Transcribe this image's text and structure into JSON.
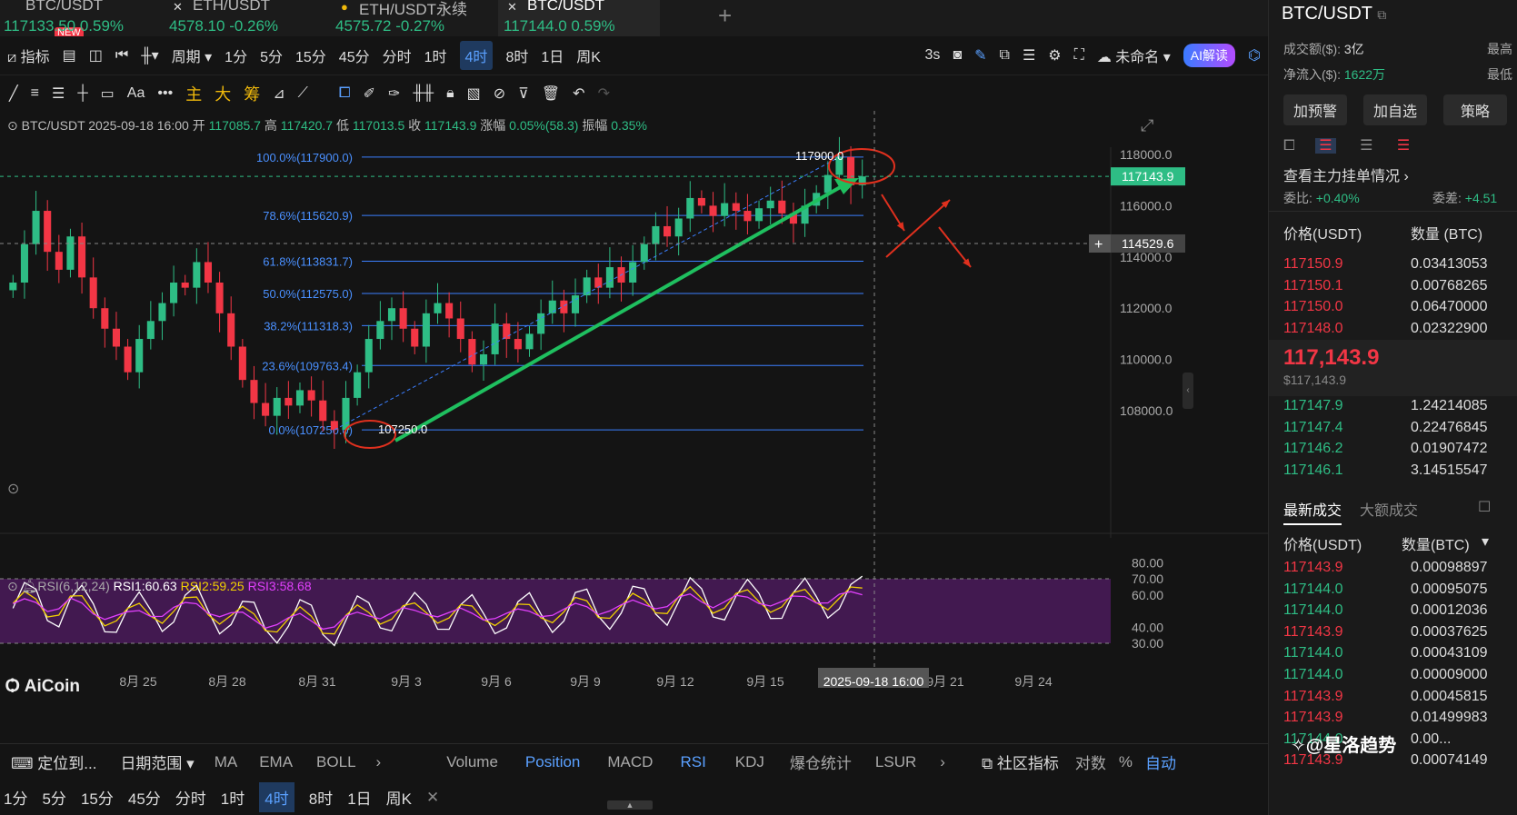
{
  "tabs": [
    {
      "name": "BTC/USDT",
      "price": "117133.50",
      "pct": "0.59%",
      "active": false,
      "icon": "",
      "badge": "NEW",
      "pcolor": "#2ebd85"
    },
    {
      "name": "ETH/USDT",
      "price": "4578.10",
      "pct": "-0.26%",
      "active": false,
      "icon": "✕",
      "pcolor": "#2ebd85"
    },
    {
      "name": "ETH/USDT永续",
      "price": "4575.72",
      "pct": "-0.27%",
      "active": false,
      "icon": "●",
      "pcolor": "#2ebd85"
    },
    {
      "name": "BTC/USDT",
      "price": "117144.0",
      "pct": "0.59%",
      "active": true,
      "icon": "✕",
      "pcolor": "#2ebd85"
    }
  ],
  "toolbar1": {
    "indicator": "指标",
    "period": "周期",
    "intervals": [
      "1分",
      "5分",
      "15分",
      "45分",
      "分时",
      "1时",
      "4时",
      "8时",
      "1日",
      "周K"
    ],
    "active_interval": "4时",
    "refresh": "3s",
    "layout_name": "未命名",
    "ai": "AI解读"
  },
  "toolbar2": {
    "main": "主",
    "big": "大",
    "chip": "筹"
  },
  "chart": {
    "info": {
      "symbol": "BTC/USDT",
      "datetime": "2025-09-18 16:00",
      "open_label": "开",
      "open": "117085.7",
      "high_label": "高",
      "high": "117420.7",
      "low_label": "低",
      "low": "117013.5",
      "close_label": "收",
      "close": "117143.9",
      "chg_label": "涨幅",
      "chg": "0.05%(58.3)",
      "amp_label": "振幅",
      "amp": "0.35%"
    },
    "y_ticks": [
      "118000.0",
      "116000.0",
      "114000.0",
      "112000.0",
      "110000.0",
      "108000.0"
    ],
    "price_tag": "117143.9",
    "cross_tag": "114529.6",
    "fib": [
      {
        "label": "100.0%(117900.0)",
        "value": 117900
      },
      {
        "label": "78.6%(115620.9)",
        "value": 115620.9
      },
      {
        "label": "61.8%(113831.7)",
        "value": 113831.7
      },
      {
        "label": "50.0%(112575.0)",
        "value": 112575.0
      },
      {
        "label": "38.2%(111318.3)",
        "value": 111318.3
      },
      {
        "label": "23.6%(109763.4)",
        "value": 109763.4
      },
      {
        "label": "0.0%(107250.0)",
        "value": 107250.0
      }
    ],
    "high_mark": "117900.0",
    "low_mark": "107250.0",
    "x_ticks": [
      "8月 25",
      "8月 28",
      "8月 31",
      "9月 3",
      "9月 6",
      "9月 9",
      "9月 12",
      "9月 15",
      "9月 18",
      "9月 21",
      "9月 24"
    ],
    "cursor_time": "2025-09-18 16:00",
    "rsi": {
      "title": "RSI(6,12,24)",
      "rsi1": "RSI1:60.63",
      "rsi2": "RSI2:59.25",
      "rsi3": "RSI3:58.68",
      "ticks": [
        "80.00",
        "70.00",
        "60.00",
        "40.00",
        "30.00"
      ]
    },
    "watermark": "AiCoin"
  },
  "bottom": {
    "locate": "定位到...",
    "range": "日期范围",
    "indicators": [
      "MA",
      "EMA",
      "BOLL",
      "Volume",
      "Position",
      "MACD",
      "RSI",
      "KDJ",
      "爆仓统计",
      "LSUR"
    ],
    "community": "社区指标",
    "log": "对数",
    "pct": "%",
    "auto": "自动"
  },
  "tf_bar": [
    "1分",
    "5分",
    "15分",
    "45分",
    "分时",
    "1时",
    "4时",
    "8时",
    "1日",
    "周K"
  ],
  "sidebar": {
    "title": "BTC/USDT",
    "volume_label": "成交额($):",
    "volume": "3亿",
    "inflow_label": "净流入($):",
    "inflow": "1622万",
    "high_label": "最高",
    "low_label": "最低",
    "buttons": [
      "加预警",
      "加自选",
      "策略"
    ],
    "depth_title": "查看主力挂单情况",
    "ratio_label": "委比:",
    "ratio": "+0.40%",
    "diff_label": "委差:",
    "diff": "+4.51",
    "ob_header_price": "价格(USDT)",
    "ob_header_qty": "数量 (BTC)",
    "asks": [
      [
        "117150.9",
        "0.03413053"
      ],
      [
        "117150.1",
        "0.00768265"
      ],
      [
        "117150.0",
        "0.06470000"
      ],
      [
        "117148.0",
        "0.02322900"
      ]
    ],
    "mid_price": "117,143.9",
    "mid_usd": "$117,143.9",
    "bids": [
      [
        "117147.9",
        "1.24214085"
      ],
      [
        "117147.4",
        "0.22476845"
      ],
      [
        "117146.2",
        "0.01907472"
      ],
      [
        "117146.1",
        "3.14515547"
      ]
    ],
    "trades_tab1": "最新成交",
    "trades_tab2": "大额成交",
    "tr_header_price": "价格(USDT)",
    "tr_header_qty": "数量(BTC)",
    "trades": [
      [
        "117143.9",
        "0.00098897",
        "red"
      ],
      [
        "117144.0",
        "0.00095075",
        "green"
      ],
      [
        "117144.0",
        "0.00012036",
        "green"
      ],
      [
        "117143.9",
        "0.00037625",
        "red"
      ],
      [
        "117144.0",
        "0.00043109",
        "green"
      ],
      [
        "117144.0",
        "0.00009000",
        "green"
      ],
      [
        "117143.9",
        "0.00045815",
        "red"
      ],
      [
        "117143.9",
        "0.01499983",
        "red"
      ],
      [
        "117144.0",
        "0.00...",
        "green"
      ],
      [
        "117143.9",
        "0.00074149",
        "red"
      ]
    ],
    "watermark": "@星洛趋势"
  }
}
